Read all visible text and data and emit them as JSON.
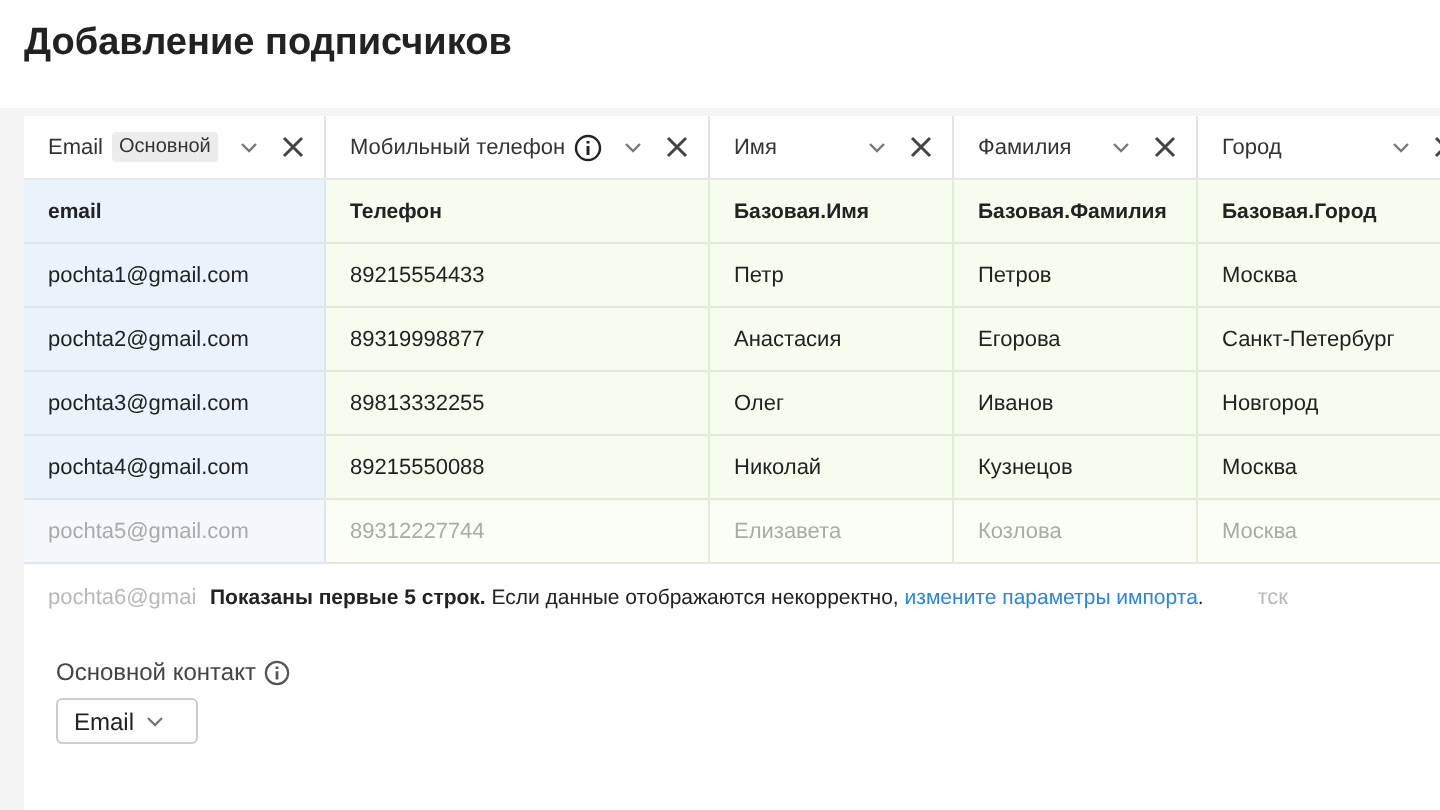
{
  "title": "Добавление подписчиков",
  "columns": [
    {
      "label": "Email",
      "badge": "Основной",
      "info": false,
      "kind": "primary"
    },
    {
      "label": "Мобильный телефон",
      "info": true,
      "kind": "field"
    },
    {
      "label": "Имя",
      "info": false,
      "kind": "field"
    },
    {
      "label": "Фамилия",
      "info": false,
      "kind": "field"
    },
    {
      "label": "Город",
      "info": false,
      "kind": "field"
    }
  ],
  "mapping": [
    "email",
    "Телефон",
    "Базовая.Имя",
    "Базовая.Фамилия",
    "Базовая.Город"
  ],
  "rows": [
    {
      "faded": false,
      "cells": [
        "pochta1@gmail.com",
        "89215554433",
        "Петр",
        "Петров",
        "Москва"
      ]
    },
    {
      "faded": false,
      "cells": [
        "pochta2@gmail.com",
        "89319998877",
        "Анастасия",
        "Егорова",
        "Санкт-Петербург"
      ]
    },
    {
      "faded": false,
      "cells": [
        "pochta3@gmail.com",
        "89813332255",
        "Олег",
        "Иванов",
        "Новгород"
      ]
    },
    {
      "faded": false,
      "cells": [
        "pochta4@gmail.com",
        "89215550088",
        "Николай",
        "Кузнецов",
        "Москва"
      ]
    },
    {
      "faded": true,
      "cells": [
        "pochta5@gmail.com",
        "89312227744",
        "Елизавета",
        "Козлова",
        "Москва"
      ]
    }
  ],
  "partial_row": {
    "email": "pochta6@gmai",
    "city": "тск"
  },
  "notice": {
    "bold": "Показаны первые 5 строк.",
    "text": "Если данные отображаются некорректно,",
    "link": "измените параметры импорта",
    "end": "."
  },
  "primary_contact": {
    "label": "Основной контакт",
    "value": "Email"
  }
}
